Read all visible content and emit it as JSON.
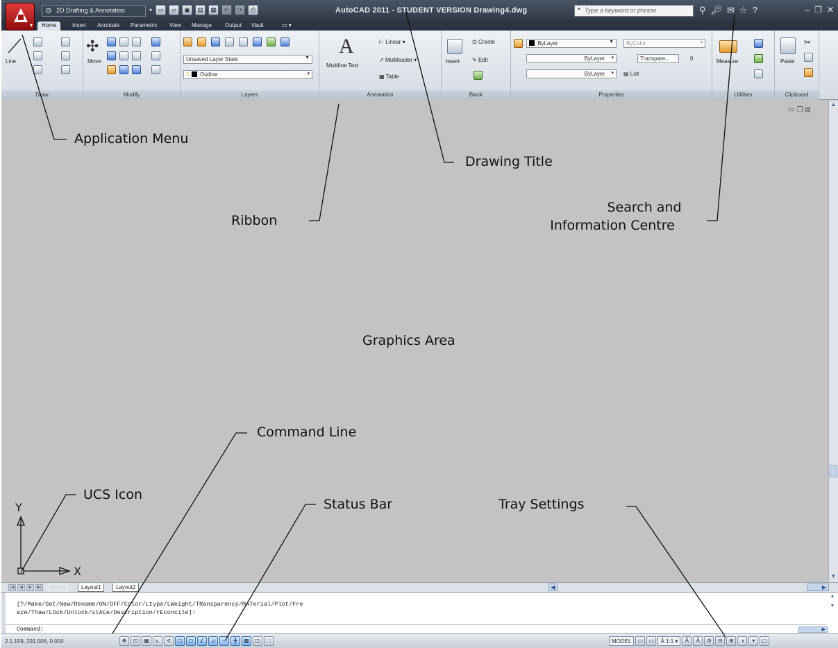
{
  "titlebar": {
    "workspace": "2D Drafting & Annotation",
    "drawing_title": "AutoCAD 2011 - STUDENT VERSION    Drawing4.dwg",
    "search_placeholder": "Type a keyword or phrase",
    "qat_icons": [
      "new-icon",
      "open-icon",
      "save-icon",
      "save-as-icon",
      "plot-icon",
      "undo-icon",
      "redo-icon",
      "print-icon"
    ]
  },
  "ribbon": {
    "tabs": [
      "Home",
      "Insert",
      "Annotate",
      "Parametric",
      "View",
      "Manage",
      "Output",
      "Vault"
    ],
    "active_tab": "Home",
    "panels": {
      "draw": {
        "title": "Draw",
        "line": "Line"
      },
      "modify": {
        "title": "Modify",
        "move": "Move"
      },
      "layers": {
        "title": "Layers",
        "layer_state": "Unsaved Layer State",
        "current_layer": "Outline"
      },
      "annotation": {
        "title": "Annotation",
        "mtext": "Multiline Text",
        "linear": "Linear",
        "multileader": "Multileader",
        "table": "Table"
      },
      "block": {
        "title": "Block",
        "insert": "Insert",
        "create": "Create",
        "edit": "Edit"
      },
      "properties": {
        "title": "Properties",
        "color": "ByLayer",
        "lineweight": "ByLayer",
        "linetype": "ByLayer",
        "plot_style": "ByColor",
        "transparency": "Transpare...",
        "transparency_value": "0",
        "list": "List"
      },
      "utilities": {
        "title": "Utilities",
        "measure": "Measure"
      },
      "clipboard": {
        "title": "Clipboard",
        "paste": "Paste"
      }
    }
  },
  "layout_tabs": [
    "Model",
    "Layout1",
    "Layout2"
  ],
  "command_line": {
    "history": "[?/Make/Set/New/Rename/ON/OFF/Color/Ltype/LWeight/TRansparency/MATerial/Plot/Fre\neze/Thaw/LOck/Unlock/stAte/Description/rEconcile]:",
    "prompt": "Command:"
  },
  "statusbar": {
    "coordinates": "2.1.159, 291.506, 0.000",
    "space": "MODEL",
    "annotation_scale": "1:1"
  },
  "annotations": {
    "application_menu": "Application Menu",
    "drawing_title": "Drawing Title",
    "ribbon": "Ribbon",
    "search_line1": "Search and",
    "search_line2": "Information Centre",
    "graphics_area": "Graphics Area",
    "command_line": "Command Line",
    "ucs_icon": "UCS Icon",
    "status_bar": "Status Bar",
    "tray_settings": "Tray Settings"
  },
  "ucs": {
    "x_label": "X",
    "y_label": "Y"
  },
  "colors": {
    "titlebar": "#2f3846",
    "graphics": "#c3c3c3",
    "app_button": "#c0282d"
  }
}
